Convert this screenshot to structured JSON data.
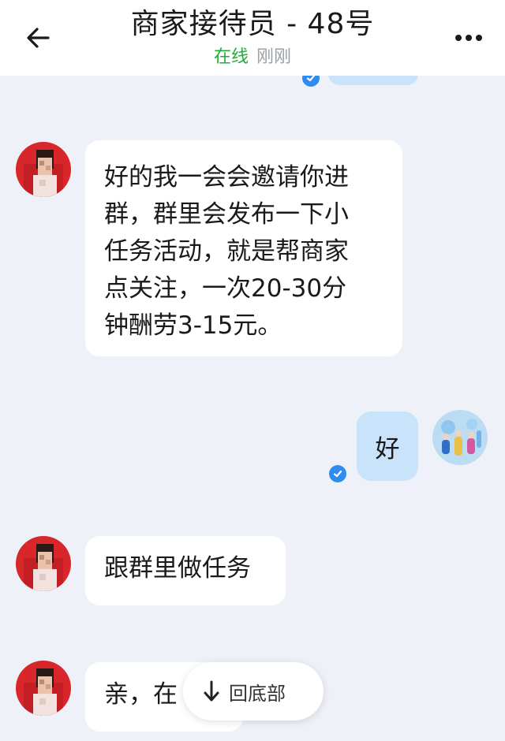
{
  "header": {
    "title": "商家接待员 - 48号",
    "status": "在线",
    "last_seen": "刚刚",
    "back_icon": "arrow-left-icon",
    "more_icon": "more-horizontal-icon"
  },
  "colors": {
    "online": "#22ac38",
    "outgoing_bubble": "#c9e3fb",
    "incoming_bubble": "#ffffff",
    "read_check": "#2e8cf0",
    "background": "#eef2f8"
  },
  "messages": [
    {
      "direction": "in",
      "lines": [
        "好的我一会会邀请你进",
        "群，群里会发布一下小",
        "任务活动，就是帮商家",
        "点关注，一次20-30分",
        "钟酬劳3-15元。"
      ]
    },
    {
      "direction": "out",
      "text": "好",
      "read_icon": "check-circle-icon"
    },
    {
      "direction": "in",
      "text": "跟群里做任务"
    },
    {
      "direction": "in",
      "text": "亲，在"
    }
  ],
  "scroll_to_bottom": {
    "label": "回底部",
    "icon": "arrow-down-icon"
  }
}
